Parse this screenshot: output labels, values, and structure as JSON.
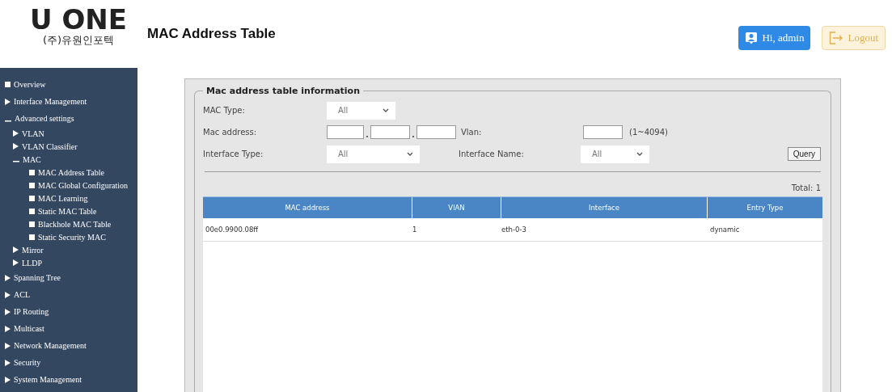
{
  "logo": {
    "wordmark": "U ONE",
    "company": "(주)유원인포텍"
  },
  "page_title": "MAC Address Table",
  "header_buttons": [
    {
      "kind": "user",
      "label": "Hi, admin"
    },
    {
      "kind": "logout",
      "label": "Logout"
    }
  ],
  "sidebar": {
    "items": [
      {
        "kind": "page",
        "label": "Overview"
      },
      {
        "kind": "folder",
        "label": "Interface Management",
        "expanded": false
      },
      {
        "kind": "folder",
        "label": "Advanced settings",
        "expanded": true,
        "children": [
          {
            "kind": "folder",
            "label": "VLAN",
            "expanded": false
          },
          {
            "kind": "folder",
            "label": "VLAN Classifier",
            "expanded": false
          },
          {
            "kind": "folder",
            "label": "MAC",
            "expanded": true,
            "children": [
              {
                "kind": "page",
                "label": "MAC Address Table"
              },
              {
                "kind": "page",
                "label": "MAC Global Configuration"
              },
              {
                "kind": "page",
                "label": "MAC Learning"
              },
              {
                "kind": "page",
                "label": "Static MAC Table"
              },
              {
                "kind": "page",
                "label": "Blackhole MAC Table"
              },
              {
                "kind": "page",
                "label": "Static Security MAC"
              }
            ]
          },
          {
            "kind": "folder",
            "label": "Mirror",
            "expanded": false
          },
          {
            "kind": "folder",
            "label": "LLDP",
            "expanded": false
          }
        ]
      },
      {
        "kind": "folder",
        "label": "Spanning Tree",
        "expanded": false
      },
      {
        "kind": "folder",
        "label": "ACL",
        "expanded": false
      },
      {
        "kind": "folder",
        "label": "IP Routing",
        "expanded": false
      },
      {
        "kind": "folder",
        "label": "Multicast",
        "expanded": false
      },
      {
        "kind": "folder",
        "label": "Network Management",
        "expanded": false
      },
      {
        "kind": "folder",
        "label": "Security",
        "expanded": false
      },
      {
        "kind": "folder",
        "label": "System Management",
        "expanded": false
      }
    ]
  },
  "form": {
    "legend": "Mac address table information",
    "mac_type": {
      "label": "MAC Type:",
      "value": "All"
    },
    "mac_address": {
      "label": "Mac address:"
    },
    "vlan": {
      "label": "Vlan:",
      "hint": "(1~4094)"
    },
    "interface_type": {
      "label": "Interface Type:",
      "value": "All"
    },
    "interface_name": {
      "label": "Interface Name:",
      "value": "All"
    },
    "query_button": "Query"
  },
  "total": "Total: 1",
  "table": {
    "columns": [
      "MAC address",
      "VlAN",
      "Interface",
      "Entry Type"
    ],
    "rows": [
      [
        "00e0.9900.08ff",
        "1",
        "eth-0-3",
        "dynamic"
      ]
    ]
  }
}
